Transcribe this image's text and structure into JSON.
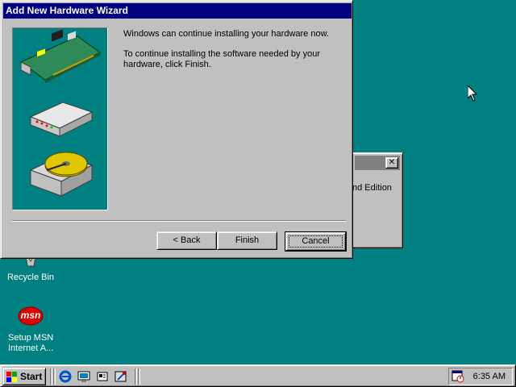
{
  "desktop": {
    "recycle_bin_label": "Recycle Bin",
    "msn_label_line1": "Setup MSN",
    "msn_label_line2": "Internet A...",
    "msn_logo_text": "msn"
  },
  "background_window": {
    "visible_text": "nd Edition",
    "close_glyph": "✕"
  },
  "wizard": {
    "title": "Add New Hardware Wizard",
    "line1": "Windows can continue installing your hardware now.",
    "line2a": "To continue installing the software needed by your",
    "line2b": "hardware, click Finish.",
    "back_label": "< Back",
    "finish_label": "Finish",
    "cancel_label": "Cancel"
  },
  "taskbar": {
    "start_label": "Start",
    "clock": "6:35 AM",
    "quick_launch": [
      "internet-explorer-icon",
      "desktop-icon",
      "outlook-express-icon",
      "channels-icon"
    ]
  },
  "colors": {
    "desktop": "#008080",
    "titlebar_active": "#000080",
    "titlebar_inactive": "#808080",
    "face": "#c0c0c0"
  }
}
